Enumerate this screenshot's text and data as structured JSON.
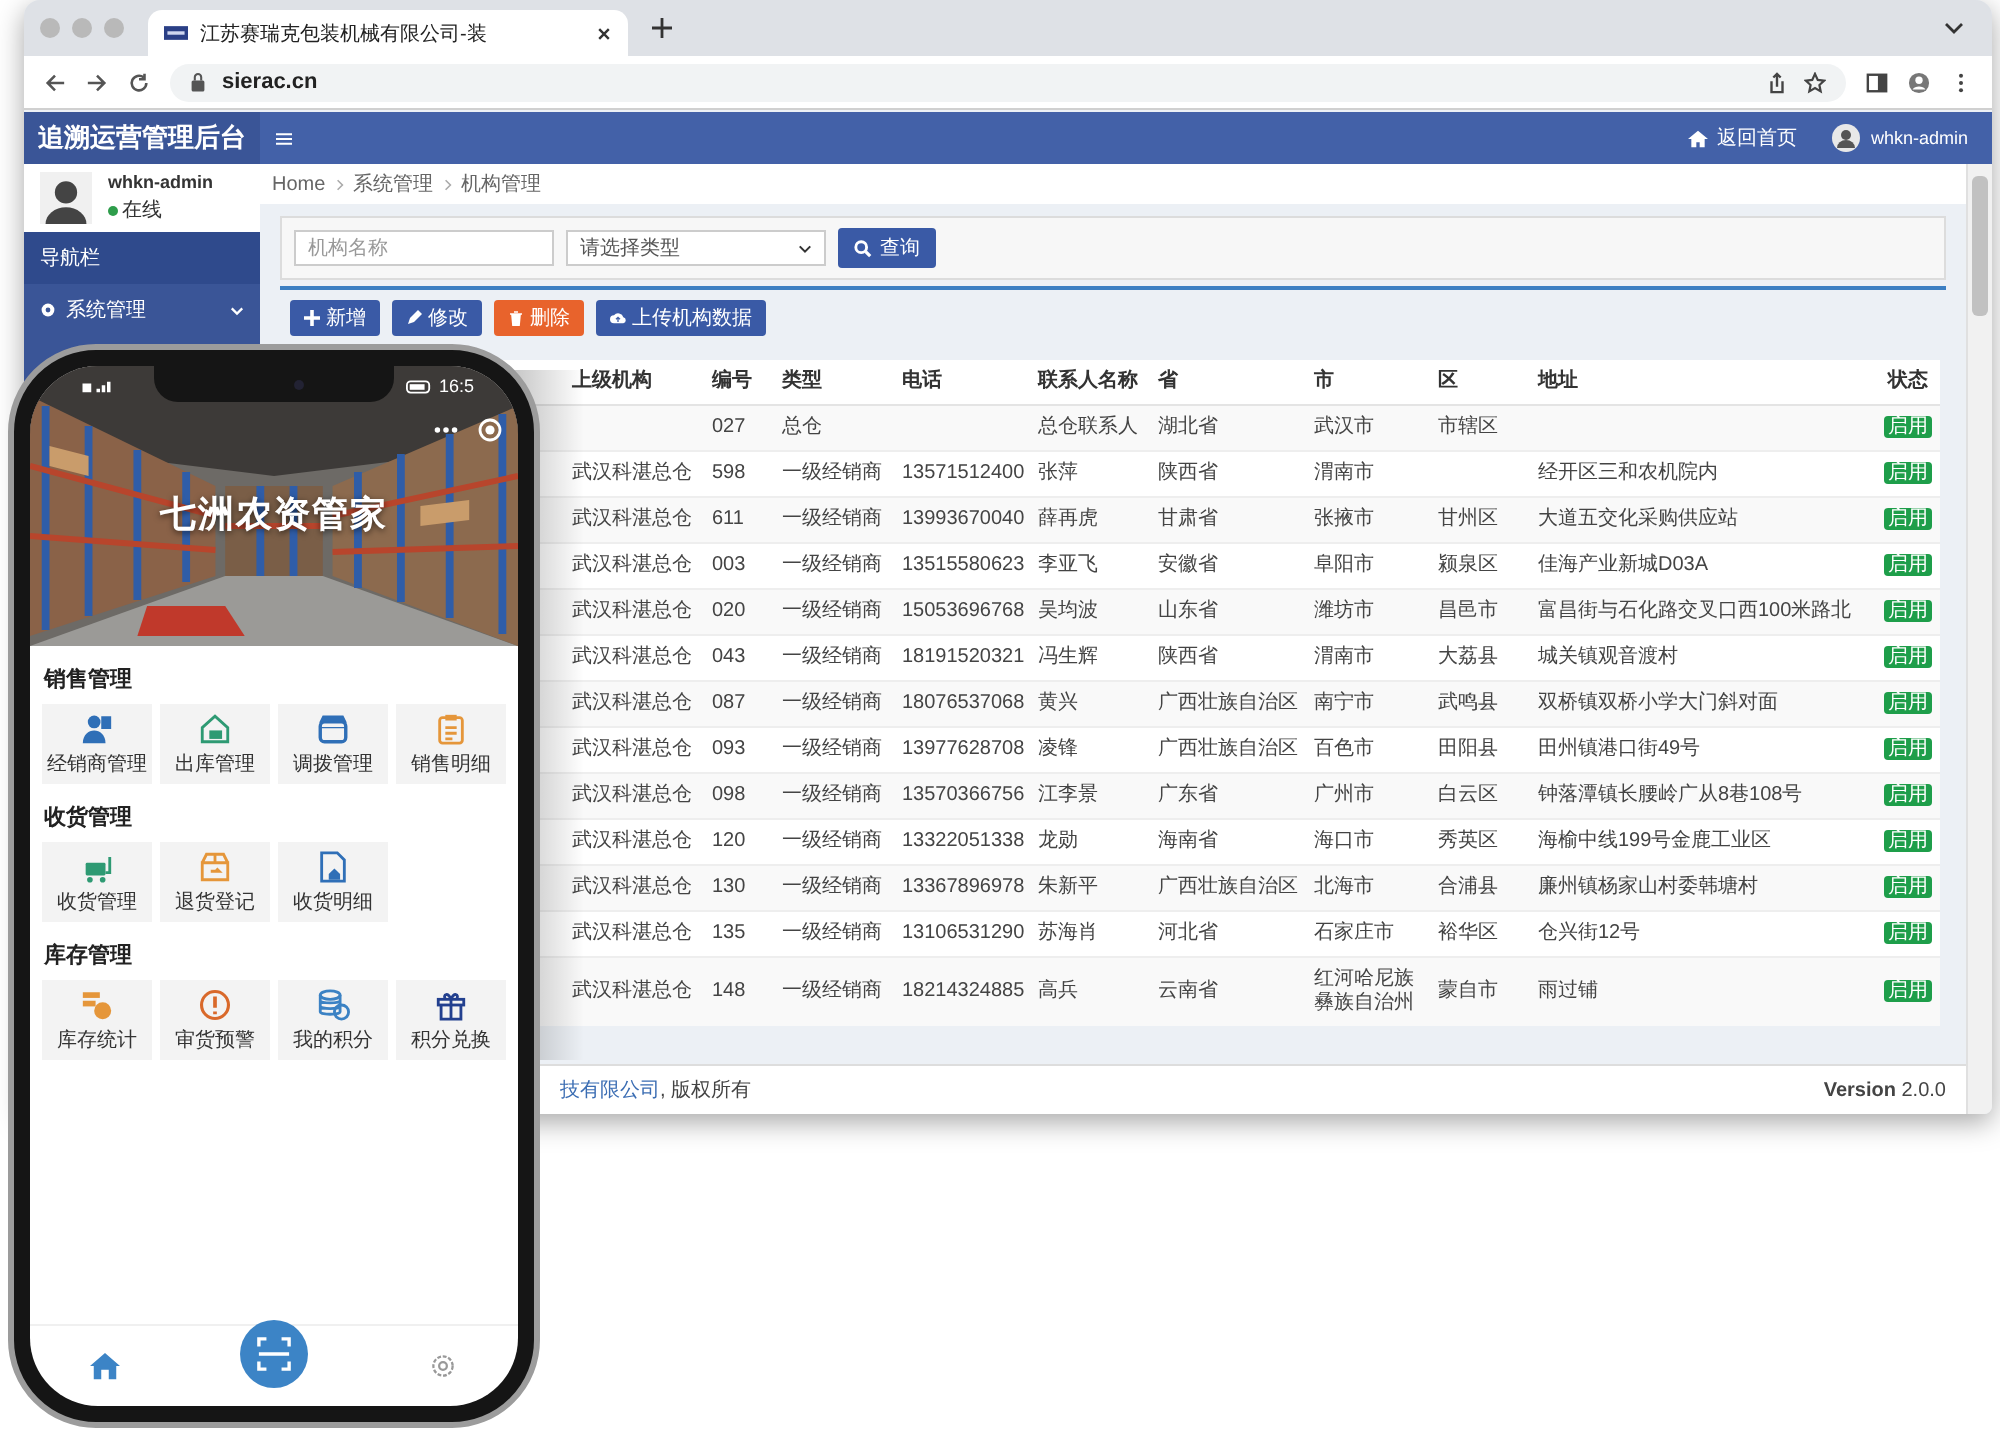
{
  "browser": {
    "tab_title": "江苏赛瑞克包装机械有限公司-装",
    "url": "sierac.cn"
  },
  "app": {
    "brand": "追溯运营管理后台",
    "home_link": "返回首页",
    "user": "whkn-admin"
  },
  "sidebar": {
    "user_name": "whkn-admin",
    "status": "在线",
    "nav_header": "导航栏",
    "items": [
      {
        "label": "系统管理",
        "expanded": true
      }
    ]
  },
  "breadcrumb": [
    "Home",
    "系统管理",
    "机构管理"
  ],
  "search": {
    "name_placeholder": "机构名称",
    "type_placeholder": "请选择类型",
    "button": "查询"
  },
  "actions": [
    {
      "label": "新增",
      "kind": "add"
    },
    {
      "label": "修改",
      "kind": "edit"
    },
    {
      "label": "删除",
      "kind": "delete"
    },
    {
      "label": "上传机构数据",
      "kind": "upload"
    }
  ],
  "table": {
    "columns": [
      "上级机构",
      "编号",
      "类型",
      "电话",
      "联系人名称",
      "省",
      "市",
      "区",
      "地址",
      "状态"
    ],
    "rows": [
      [
        "",
        "027",
        "总仓",
        "",
        "总仓联系人",
        "湖北省",
        "武汉市",
        "市辖区",
        "",
        "启用"
      ],
      [
        "武汉科湛总仓",
        "598",
        "一级经销商",
        "13571512400",
        "张萍",
        "陕西省",
        "渭南市",
        "",
        "经开区三和农机院内",
        "启用"
      ],
      [
        "武汉科湛总仓",
        "611",
        "一级经销商",
        "13993670040",
        "薛再虎",
        "甘肃省",
        "张掖市",
        "甘州区",
        "大道五交化采购供应站",
        "启用"
      ],
      [
        "武汉科湛总仓",
        "003",
        "一级经销商",
        "13515580623",
        "李亚飞",
        "安徽省",
        "阜阳市",
        "颍泉区",
        "佳海产业新城D03A",
        "启用"
      ],
      [
        "武汉科湛总仓",
        "020",
        "一级经销商",
        "15053696768",
        "吴均波",
        "山东省",
        "潍坊市",
        "昌邑市",
        "富昌街与石化路交叉口西100米路北",
        "启用"
      ],
      [
        "武汉科湛总仓",
        "043",
        "一级经销商",
        "18191520321",
        "冯生辉",
        "陕西省",
        "渭南市",
        "大荔县",
        "城关镇观音渡村",
        "启用"
      ],
      [
        "武汉科湛总仓",
        "087",
        "一级经销商",
        "18076537068",
        "黄兴",
        "广西壮族自治区",
        "南宁市",
        "武鸣县",
        "双桥镇双桥小学大门斜对面",
        "启用"
      ],
      [
        "武汉科湛总仓",
        "093",
        "一级经销商",
        "13977628708",
        "凌锋",
        "广西壮族自治区",
        "百色市",
        "田阳县",
        "田州镇港口街49号",
        "启用"
      ],
      [
        "武汉科湛总仓",
        "098",
        "一级经销商",
        "13570366756",
        "江李景",
        "广东省",
        "广州市",
        "白云区",
        "钟落潭镇长腰岭广从8巷108号",
        "启用"
      ],
      [
        "武汉科湛总仓",
        "120",
        "一级经销商",
        "13322051338",
        "龙勋",
        "海南省",
        "海口市",
        "秀英区",
        "海榆中线199号金鹿工业区",
        "启用"
      ],
      [
        "武汉科湛总仓",
        "130",
        "一级经销商",
        "13367896978",
        "朱新平",
        "广西壮族自治区",
        "北海市",
        "合浦县",
        "廉州镇杨家山村委韩塘村",
        "启用"
      ],
      [
        "武汉科湛总仓",
        "135",
        "一级经销商",
        "13106531290",
        "苏海肖",
        "河北省",
        "石家庄市",
        "裕华区",
        "仓兴街12号",
        "启用"
      ],
      [
        "武汉科湛总仓",
        "148",
        "一级经销商",
        "18214324885",
        "高兵",
        "云南省",
        "红河哈尼族彝族自治州",
        "蒙自市",
        "雨过铺",
        "启用"
      ]
    ]
  },
  "footer": {
    "company": "技有限公司",
    "rights": ", 版权所有",
    "version": "**Version** 2.0.0"
  },
  "phone": {
    "time": "16:5",
    "title": "七洲农资管家",
    "sections": [
      {
        "title": "销售管理",
        "items": [
          {
            "label": "经销商管理",
            "color": "#2f6fb7"
          },
          {
            "label": "出库管理",
            "color": "#2e9a73"
          },
          {
            "label": "调拨管理",
            "color": "#2f6fb7"
          },
          {
            "label": "销售明细",
            "color": "#e5963a"
          }
        ]
      },
      {
        "title": "收货管理",
        "items": [
          {
            "label": "收货管理",
            "color": "#2e9a73"
          },
          {
            "label": "退货登记",
            "color": "#e5963a"
          },
          {
            "label": "收货明细",
            "color": "#2f6fb7"
          }
        ]
      },
      {
        "title": "库存管理",
        "items": [
          {
            "label": "库存统计",
            "color": "#e5963a"
          },
          {
            "label": "审货预警",
            "color": "#d9692b"
          },
          {
            "label": "我的积分",
            "color": "#3b82c4"
          },
          {
            "label": "积分兑换",
            "color": "#23408f"
          }
        ]
      }
    ],
    "tabbar": [
      {
        "kind": "home",
        "selected": true
      },
      {
        "kind": "scan",
        "selected": false
      },
      {
        "kind": "settings",
        "selected": false
      }
    ]
  }
}
